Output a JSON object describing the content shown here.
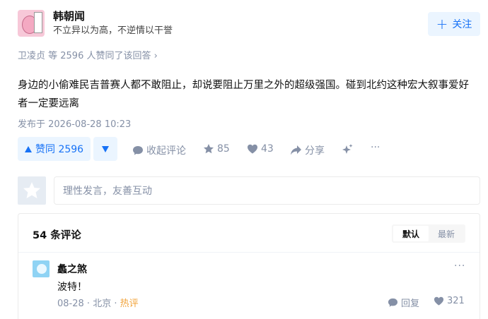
{
  "author": {
    "name": "韩朝闻",
    "bio": "不立异以为高，不逆情以干誉"
  },
  "follow_button": {
    "label": "关注"
  },
  "voters": {
    "text": "卫凌贞 等 2596 人赞同了该回答",
    "chevron": "›"
  },
  "answer": {
    "content": "身边的小偷难民吉普赛人都不敢阻止，却说要阻止万里之外的超级强国。碰到北约这种宏大叙事爱好者一定要远离",
    "published": "发布于 2026-08-28 10:23"
  },
  "actions": {
    "upvote": "赞同 2596",
    "collapse_comments": "收起评论",
    "favorites": "85",
    "likes": "43",
    "share": "分享",
    "more": "···"
  },
  "comment_input": {
    "placeholder": "理性发言，友善互动"
  },
  "comments": {
    "count_label": "54 条评论",
    "sort_default": "默认",
    "sort_latest": "最新",
    "items": [
      {
        "author": "蠡之煞",
        "text": "波特！",
        "date": "08-28",
        "location": "北京",
        "tag": "热评",
        "reply_label": "回复",
        "likes": "321",
        "more": "···"
      }
    ]
  },
  "colors": {
    "accent": "#1772f6",
    "accent_bg": "#ebf5ff",
    "muted": "#8590a6",
    "hot": "#f1a33a"
  }
}
